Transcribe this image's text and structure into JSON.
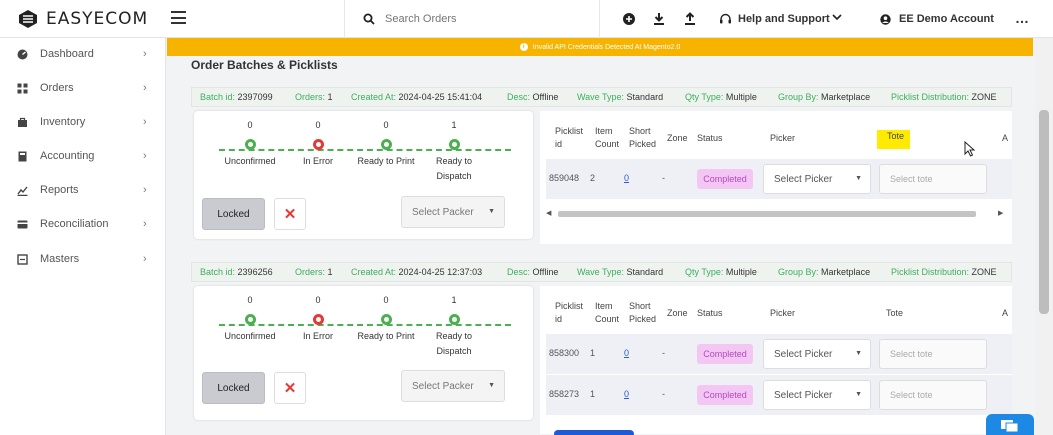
{
  "brand": {
    "name": "EASYECOM"
  },
  "topbar": {
    "search_placeholder": "Search Orders",
    "help": "Help and Support",
    "account": "EE Demo Account",
    "more": "…"
  },
  "sidebar": {
    "items": [
      {
        "label": "Dashboard",
        "icon": "dashboard-icon"
      },
      {
        "label": "Orders",
        "icon": "orders-icon"
      },
      {
        "label": "Inventory",
        "icon": "inventory-icon"
      },
      {
        "label": "Accounting",
        "icon": "accounting-icon"
      },
      {
        "label": "Reports",
        "icon": "reports-icon"
      },
      {
        "label": "Reconciliation",
        "icon": "reconciliation-icon"
      },
      {
        "label": "Masters",
        "icon": "masters-icon"
      }
    ]
  },
  "banner": {
    "text": "Invalid API Credentials Detected At Magento2.0"
  },
  "page": {
    "title": "Order Batches & Picklists"
  },
  "labels": {
    "batch_id": "Batch id:",
    "orders": "Orders:",
    "created_at": "Created At:",
    "desc": "Desc:",
    "wave_type": "Wave Type:",
    "qty_type": "Qty Type:",
    "group_by": "Group By:",
    "picklist_distribution": "Picklist Distribution:",
    "locked": "Locked",
    "close": "✕",
    "select_packer": "Select Packer",
    "select_picker": "Select Picker",
    "select_tote": "Select tote"
  },
  "table_headers": {
    "picklist_id": [
      "Picklist",
      "id"
    ],
    "item_count": [
      "Item",
      "Count"
    ],
    "short_picked": [
      "Short",
      "Picked"
    ],
    "zone": "Zone",
    "status": "Status",
    "picker": "Picker",
    "tote": "Tote",
    "next": "A"
  },
  "steps": [
    {
      "label": "Unconfirmed",
      "color": "#4caf50"
    },
    {
      "label": "In Error",
      "color": "#e53935"
    },
    {
      "label": "Ready to Print",
      "color": "#4caf50"
    },
    {
      "label": "Ready to Dispatch",
      "color": "#4caf50"
    }
  ],
  "batches": [
    {
      "batch_id": "2397099",
      "orders": "1",
      "created_at": "2024-04-25 15:41:04",
      "desc": "Offline",
      "wave_type": "Standard",
      "qty_type": "Multiple",
      "group_by": "Marketplace",
      "picklist_distribution": "ZONE",
      "counts": [
        "0",
        "0",
        "0",
        "1"
      ],
      "picklists": [
        {
          "id": "859048",
          "item_count": "2",
          "short_picked": "0",
          "zone": "-",
          "status": "Completed"
        }
      ]
    },
    {
      "batch_id": "2396256",
      "orders": "1",
      "created_at": "2024-04-25 12:37:03",
      "desc": "Offline",
      "wave_type": "Standard",
      "qty_type": "Multiple",
      "group_by": "Marketplace",
      "picklist_distribution": "ZONE",
      "counts": [
        "0",
        "0",
        "0",
        "1"
      ],
      "picklists": [
        {
          "id": "858300",
          "item_count": "1",
          "short_picked": "0",
          "zone": "-",
          "status": "Completed"
        },
        {
          "id": "858273",
          "item_count": "1",
          "short_picked": "0",
          "zone": "-",
          "status": "Completed"
        }
      ]
    }
  ],
  "colors": {
    "accent_green": "#3fae5d",
    "banner_yellow": "#f6b400",
    "badge_bg": "#f3c6f3",
    "badge_text": "#b14bc1",
    "error_red": "#e53935"
  }
}
